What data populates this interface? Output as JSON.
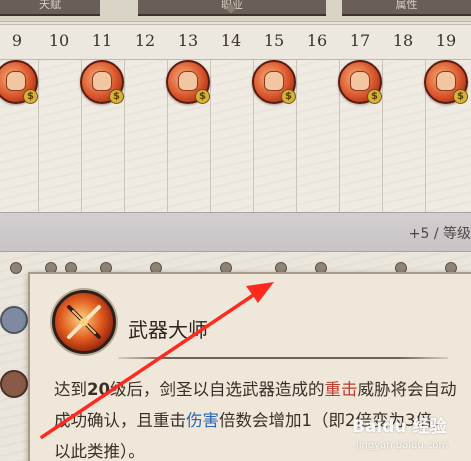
{
  "top_tabs": [
    {
      "label": "天赋"
    },
    {
      "label": "职业"
    },
    {
      "label": "属性"
    }
  ],
  "levels": [
    "9",
    "10",
    "11",
    "12",
    "13",
    "14",
    "15",
    "16",
    "17",
    "18",
    "19"
  ],
  "feature_icon": "fist-icon",
  "level_bar": {
    "text": "+5 / 等级"
  },
  "tooltip": {
    "title": "武器大师",
    "icon": "crossed-weapons-icon",
    "body": {
      "seg1": "达到",
      "seg2": "20",
      "seg3": "级后，剑圣以自选武器造成的",
      "seg4": "重击",
      "seg5": "威胁将会自动成功确认，且重击",
      "seg6": "伤害",
      "seg7": "倍数会增加",
      "seg8": "1（即2倍变为3倍，以此类推）。"
    }
  },
  "watermark": {
    "brand": "Baidu 经验",
    "url": "jingyan.baidu.com"
  },
  "colors": {
    "highlight_red": "#c0392b",
    "highlight_blue": "#2b63b8",
    "arrow": "#ff2a1f"
  }
}
